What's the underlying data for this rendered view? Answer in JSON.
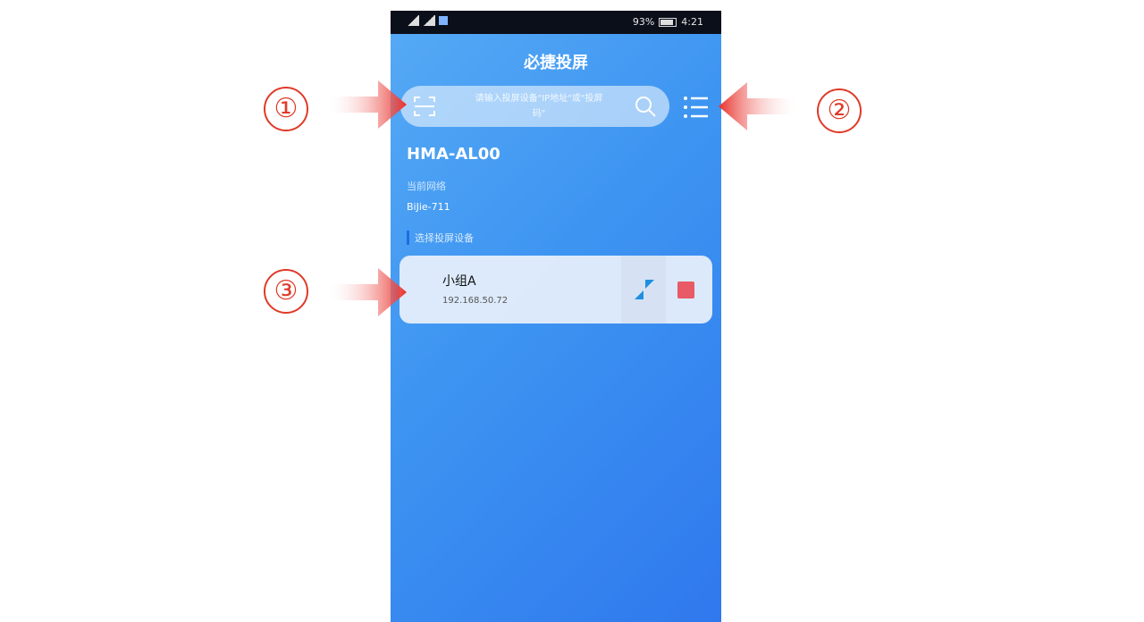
{
  "status_bar": {
    "battery": "93%",
    "time": "4:21"
  },
  "app": {
    "title": "必捷投屏"
  },
  "search": {
    "placeholder": "请输入投屏设备\"IP地址\"或\"投屏码\""
  },
  "device": {
    "name": "HMA-AL00"
  },
  "network": {
    "label": "当前网络",
    "name": "BiJie-711"
  },
  "section": {
    "title": "选择投屏设备"
  },
  "devices": [
    {
      "name": "小组A",
      "ip": "192.168.50.72"
    }
  ],
  "annotations": [
    "①",
    "②",
    "③"
  ],
  "colors": {
    "accent_red": "#e03a28",
    "stop_red": "#e75a66",
    "cast_blue": "#1e8fe0"
  }
}
